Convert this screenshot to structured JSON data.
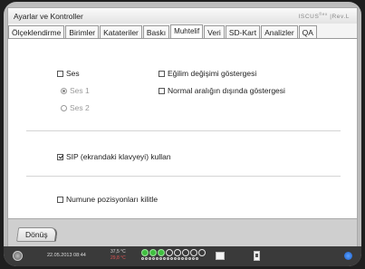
{
  "window": {
    "title": "Ayarlar ve Kontroller",
    "brand": "ISCUS",
    "brand_suffix": "flex",
    "brand_tag": "|Rev.L"
  },
  "tabs": [
    {
      "label": "Ölçeklendirme",
      "active": false
    },
    {
      "label": "Birimler",
      "active": false
    },
    {
      "label": "Katateriler",
      "active": false
    },
    {
      "label": "Baskı",
      "active": false
    },
    {
      "label": "Muhtelif",
      "active": true
    },
    {
      "label": "Veri",
      "active": false
    },
    {
      "label": "SD-Kart",
      "active": false
    },
    {
      "label": "Analizler",
      "active": false
    },
    {
      "label": "QA",
      "active": false
    }
  ],
  "settings": {
    "sound": {
      "label": "Ses",
      "checked": false
    },
    "sound1": {
      "label": "Ses 1",
      "selected": true,
      "enabled": false
    },
    "sound2": {
      "label": "Ses 2",
      "selected": false,
      "enabled": false
    },
    "trend": {
      "label": "Eğilim değişimi göstergesi",
      "checked": false
    },
    "normal_range": {
      "label": "Normal aralığın dışında göstergesi",
      "checked": false
    },
    "sip": {
      "label": "SIP (ekrandaki klavyeyi) kullan",
      "checked": true
    },
    "lock_positions": {
      "label": "Numune pozisyonları kilitle",
      "checked": false
    }
  },
  "footer": {
    "back_label": "Dönüş"
  },
  "status": {
    "datetime": "22.05.2013 08:44",
    "temp1": "37,5 °C",
    "temp2": "29,8 °C",
    "icons": [
      "power-icon",
      "sample-slot-indicator",
      "keyboard-icon",
      "usb-icon",
      "network-icon"
    ]
  },
  "colors": {
    "active_slot": "#3fbf3f",
    "alert_temp": "#e05555",
    "network": "#1d5fc8"
  }
}
